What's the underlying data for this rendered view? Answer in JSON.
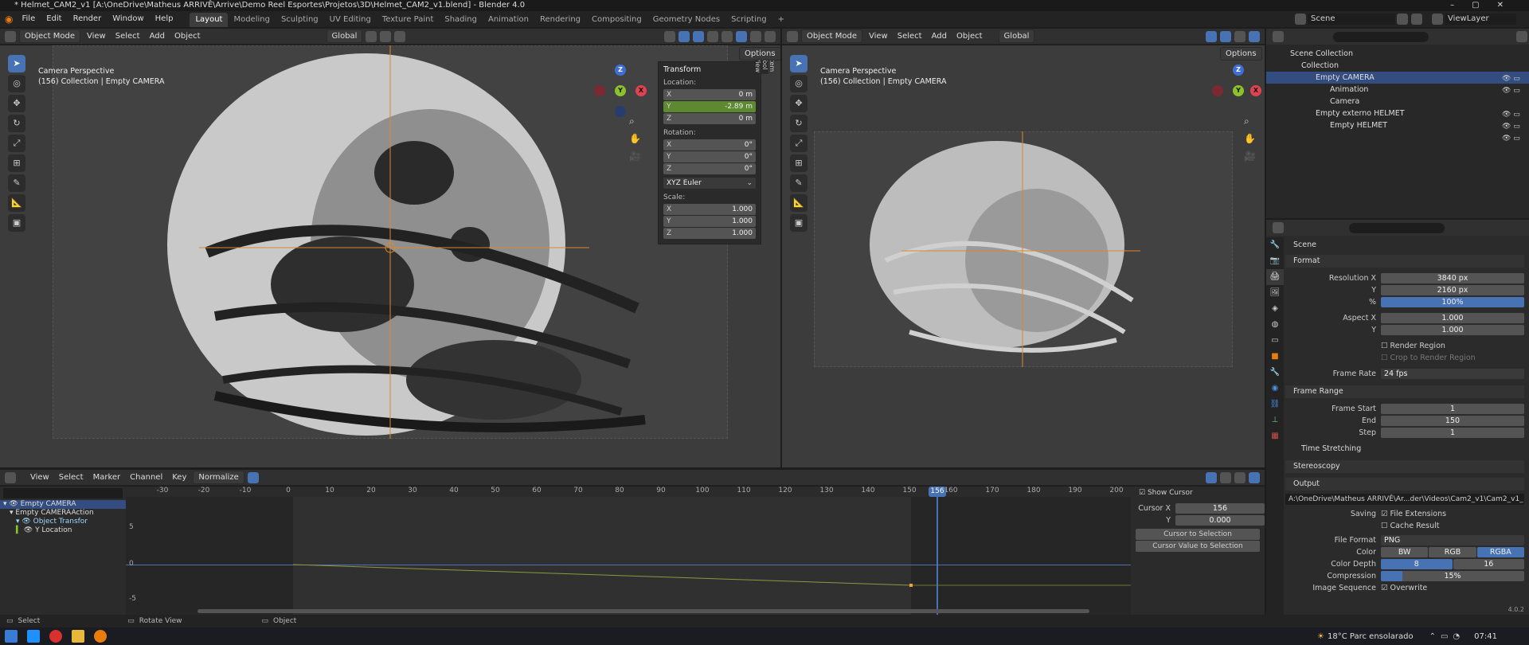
{
  "window": {
    "title": "* Helmet_CAM2_v1 [A:\\OneDrive\\Matheus ARRIVÊ\\Arrive\\Demo Reel Esportes\\Projetos\\3D\\Helmet_CAM2_v1.blend] - Blender 4.0"
  },
  "menus": [
    "File",
    "Edit",
    "Render",
    "Window",
    "Help"
  ],
  "workspaces": [
    "Layout",
    "Modeling",
    "Sculpting",
    "UV Editing",
    "Texture Paint",
    "Shading",
    "Animation",
    "Rendering",
    "Compositing",
    "Geometry Nodes",
    "Scripting"
  ],
  "scene": {
    "name": "Scene",
    "viewlayer": "ViewLayer"
  },
  "viewport_left": {
    "mode": "Object Mode",
    "menus": [
      "View",
      "Select",
      "Add",
      "Object"
    ],
    "orientation": "Global",
    "options": "Options",
    "label_line1": "Camera Perspective",
    "label_line2": "(156) Collection | Empty CAMERA",
    "npanel_tabs": [
      "Item",
      "Tool",
      "View"
    ],
    "transform": {
      "title": "Transform",
      "location_label": "Location:",
      "location": [
        {
          "k": "X",
          "v": "0 m"
        },
        {
          "k": "Y",
          "v": "-2.89 m"
        },
        {
          "k": "Z",
          "v": "0 m"
        }
      ],
      "rotation_label": "Rotation:",
      "rotation": [
        {
          "k": "X",
          "v": "0°"
        },
        {
          "k": "Y",
          "v": "0°"
        },
        {
          "k": "Z",
          "v": "0°"
        }
      ],
      "rotation_mode": "XYZ Euler",
      "scale_label": "Scale:",
      "scale": [
        {
          "k": "X",
          "v": "1.000"
        },
        {
          "k": "Y",
          "v": "1.000"
        },
        {
          "k": "Z",
          "v": "1.000"
        }
      ]
    }
  },
  "viewport_right": {
    "mode": "Object Mode",
    "menus": [
      "View",
      "Select",
      "Add",
      "Object"
    ],
    "orientation": "Global",
    "options": "Options",
    "label_line1": "Camera Perspective",
    "label_line2": "(156) Collection | Empty CAMERA"
  },
  "gizmo": {
    "z": "Z",
    "y": "Y",
    "x": "X"
  },
  "outliner": {
    "rows": [
      {
        "label": "Scene Collection",
        "indent": 0,
        "selected": false
      },
      {
        "label": "Collection",
        "indent": 1,
        "selected": false
      },
      {
        "label": "Empty CAMERA",
        "indent": 2,
        "selected": true
      },
      {
        "label": "Animation",
        "indent": 3,
        "selected": false
      },
      {
        "label": "Camera",
        "indent": 3,
        "selected": false
      },
      {
        "label": "Empty externo HELMET",
        "indent": 2,
        "selected": false
      },
      {
        "label": "Empty HELMET",
        "indent": 3,
        "selected": false
      }
    ]
  },
  "properties": {
    "header": "Scene",
    "format_title": "Format",
    "resolution_x_label": "Resolution X",
    "resolution_x": "3840 px",
    "resolution_y_label": "Y",
    "resolution_y": "2160 px",
    "percent_label": "%",
    "percent": "100%",
    "aspect_x_label": "Aspect X",
    "aspect_x": "1.000",
    "aspect_y_label": "Y",
    "aspect_y": "1.000",
    "render_region": "Render Region",
    "crop_region": "Crop to Render Region",
    "frame_rate_label": "Frame Rate",
    "frame_rate": "24 fps",
    "frame_range_title": "Frame Range",
    "frame_start_label": "Frame Start",
    "frame_start": "1",
    "end_label": "End",
    "end": "150",
    "step_label": "Step",
    "step": "1",
    "time_stretching": "Time Stretching",
    "stereoscopy": "Stereoscopy",
    "output_title": "Output",
    "output_path": "A:\\OneDrive\\Matheus ARRIVÊ\\Ar...der\\Videos\\Cam2_v1\\Cam2_v1_",
    "saving_label": "Saving",
    "file_extensions": "File Extensions",
    "cache_result": "Cache Result",
    "file_format_label": "File Format",
    "file_format": "PNG",
    "color_label": "Color",
    "color_options": [
      "BW",
      "RGB",
      "RGBA"
    ],
    "color_depth_label": "Color Depth",
    "color_depth": [
      "8",
      "16"
    ],
    "compression_label": "Compression",
    "compression": "15%",
    "compression_level": 0.15,
    "image_sequence_label": "Image Sequence",
    "overwrite": "Overwrite",
    "version": "4.0.2"
  },
  "dopesheet": {
    "menus": [
      "View",
      "Select",
      "Marker",
      "Channel",
      "Key"
    ],
    "normalize": "Normalize",
    "channels": [
      "Empty CAMERA",
      "Empty CAMERAAction",
      "Object Transfor",
      "Y Location"
    ],
    "ticks": [
      "-30",
      "-20",
      "-10",
      "0",
      "10",
      "20",
      "30",
      "40",
      "50",
      "60",
      "70",
      "80",
      "90",
      "100",
      "110",
      "120",
      "130",
      "140",
      "150",
      "160",
      "170",
      "180",
      "190",
      "200"
    ],
    "current_frame": "156",
    "y_labels": [
      "5",
      "0",
      "-5"
    ],
    "cursor_panel": {
      "title": "Show Cursor",
      "cursor_x_label": "Cursor X",
      "cursor_x": "156",
      "y_label": "Y",
      "y": "0.000",
      "btn1": "Cursor to Selection",
      "btn2": "Cursor Value to Selection"
    }
  },
  "status": {
    "select": "Select",
    "rotate": "Rotate View",
    "object": "Object"
  },
  "taskbar": {
    "weather": "18°C  Parc ensolarado",
    "time": "07:41"
  }
}
